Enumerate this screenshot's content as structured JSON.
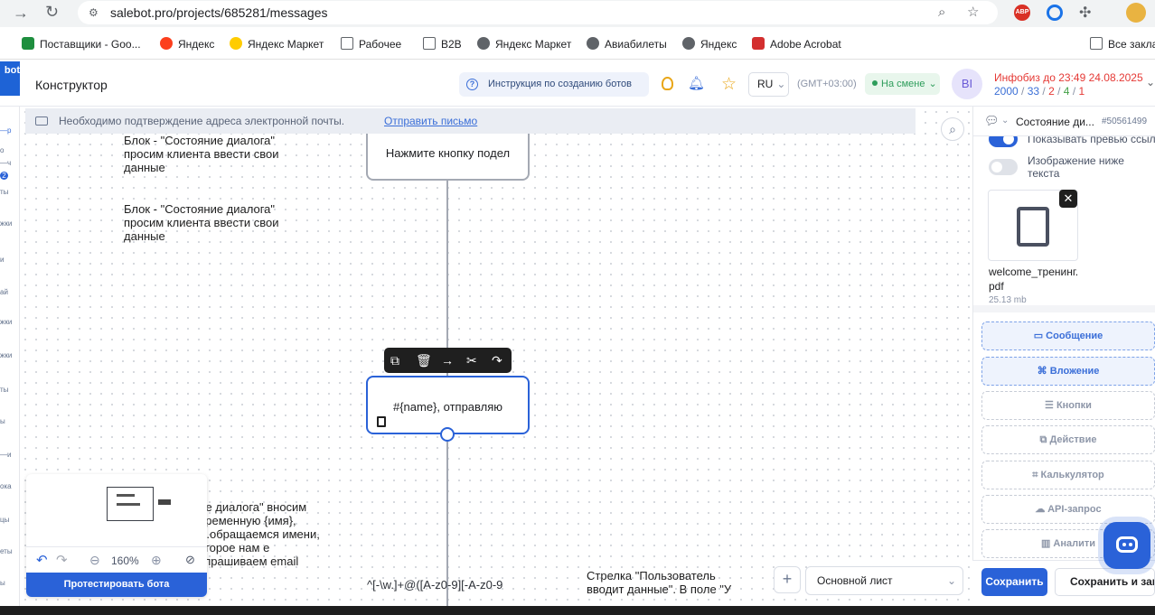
{
  "browser": {
    "url": "salebot.pro/projects/685281/messages"
  },
  "bookmarks": [
    {
      "label": "Поставщики - Goo...",
      "color": "#1e8e3e"
    },
    {
      "label": "Яндекс",
      "color": "#fc3f1d"
    },
    {
      "label": "Яндекс Маркет",
      "color": "#ffcc00"
    },
    {
      "label": "Рабочее",
      "color": "#5f6368"
    },
    {
      "label": "B2B",
      "color": "#5f6368"
    },
    {
      "label": "Яндекс Маркет",
      "color": "#5f6368"
    },
    {
      "label": "Авиабилеты",
      "color": "#5f6368"
    },
    {
      "label": "Яндекс",
      "color": "#5f6368"
    },
    {
      "label": "Adobe Acrobat",
      "color": "#d32f2f"
    },
    {
      "label": "Все закла",
      "color": "#5f6368"
    }
  ],
  "header": {
    "logo": "bot",
    "title": "Конструктор",
    "instruction": "Инструкция по созданию ботов",
    "lang": "RU",
    "timezone": "(GMT+03:00)",
    "status": "На смене",
    "avatar": "BI",
    "info": "Инфобиз до 23:49 24.08.2025",
    "stats": [
      {
        "value": "2000",
        "color": "#3b6fd6"
      },
      {
        "value": "33",
        "color": "#3b6fd6"
      },
      {
        "value": "2",
        "color": "#e53935"
      },
      {
        "value": "4",
        "color": "#43a047"
      },
      {
        "value": "1",
        "color": "#e53935"
      }
    ]
  },
  "notice": {
    "text": "Необходимо подтверждение адреса электронной почты.",
    "link": "Отправить письмо"
  },
  "sidebar_left": [
    "—р",
    "о",
    "—ч",
    "2",
    "ты",
    "жки",
    "и",
    "ай",
    "жки",
    "жки",
    "ты",
    "ы",
    "—и",
    "ока",
    "цы",
    "еты",
    "ы"
  ],
  "canvas": {
    "texts": [
      "Блок - \"Состояние диалога\" просим клиента ввести свои данные",
      "Блок - \"Состояние диалога\" просим клиента ввести свои данные",
      "ние диалога\" вносим переменную {имя}, т.е.обращаемся имени, которое нам е запрашиваем email",
      "^[-\\w.]+@([A-z0-9][-A-z0-9",
      "Стрелка \"Пользователь вводит данные\". В поле \"У"
    ],
    "node_top": "Нажмите кнопку подел",
    "node_selected": "#{name}, отправляю",
    "zoom": "160%",
    "test_button": "Протестировать бота",
    "sheet": "Основной лист"
  },
  "panel": {
    "title": "Состояние ди...",
    "id": "#50561499",
    "toggle1": "Показывать превью ссыл",
    "toggle2": "Изображение ниже текста",
    "file_name": "welcome_тренинг.pdf",
    "file_size": "25.13 mb",
    "buttons": [
      "Сообщение",
      "Вложение",
      "Кнопки",
      "Действие",
      "Калькулятор",
      "API-запрос",
      "Аналити"
    ],
    "save": "Сохранить",
    "save_close": "Сохранить и закр"
  }
}
